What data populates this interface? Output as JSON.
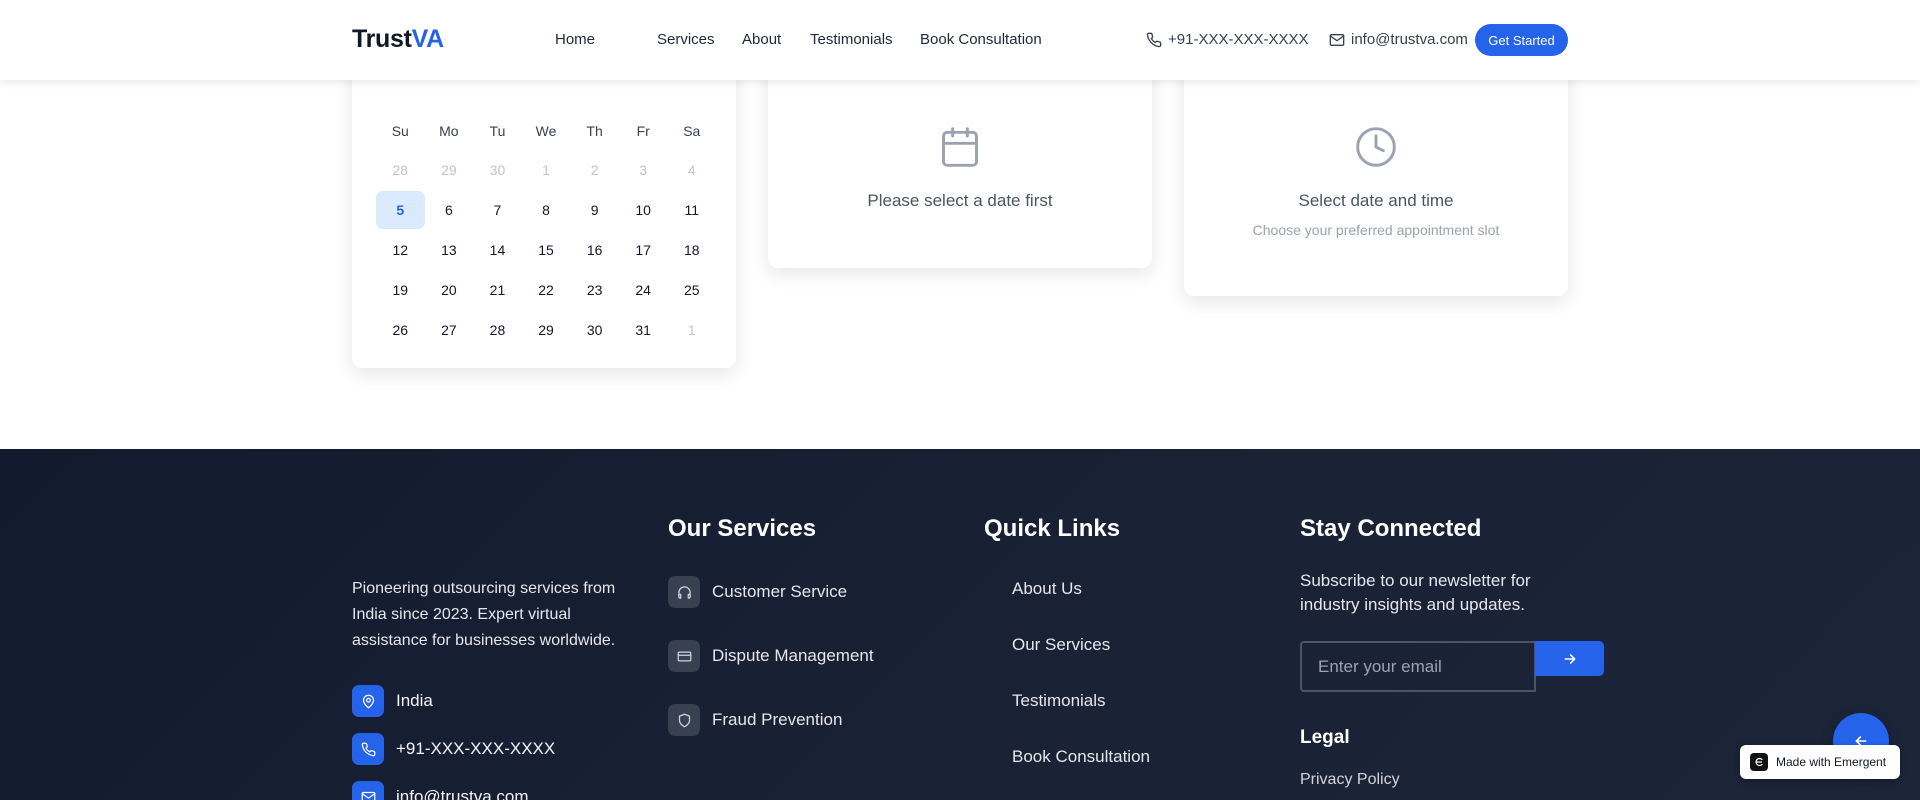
{
  "header": {
    "logo_main": "Trust",
    "logo_accent": "VA",
    "nav": [
      "Home",
      "Services",
      "About",
      "Testimonials",
      "Book Consultation"
    ],
    "phone": "+91-XXX-XXX-XXXX",
    "email": "info@trustva.com",
    "cta_label": "Get Started"
  },
  "calendar": {
    "weekdays": [
      "Su",
      "Mo",
      "Tu",
      "We",
      "Th",
      "Fr",
      "Sa"
    ],
    "rows": [
      [
        "28",
        "29",
        "30",
        "1",
        "2",
        "3",
        "4"
      ],
      [
        "5",
        "6",
        "7",
        "8",
        "9",
        "10",
        "11"
      ],
      [
        "12",
        "13",
        "14",
        "15",
        "16",
        "17",
        "18"
      ],
      [
        "19",
        "20",
        "21",
        "22",
        "23",
        "24",
        "25"
      ],
      [
        "26",
        "27",
        "28",
        "29",
        "30",
        "31",
        "1"
      ]
    ],
    "selected_day": "5"
  },
  "time_slots": {
    "message": "Please select a date first",
    "icon": "calendar-icon"
  },
  "summary": {
    "title": "Select date and time",
    "subtitle": "Choose your preferred appointment slot",
    "icon": "clock-icon"
  },
  "footer": {
    "about_text": "Pioneering outsourcing services from India since 2023. Expert virtual assistance for businesses worldwide.",
    "contact": {
      "location": "India",
      "phone": "+91-XXX-XXX-XXXX",
      "email": "info@trustva.com"
    },
    "services_title": "Our Services",
    "services": [
      {
        "label": "Customer Service",
        "icon": "headphones-icon"
      },
      {
        "label": "Dispute Management",
        "icon": "credit-card-icon"
      },
      {
        "label": "Fraud Prevention",
        "icon": "shield-icon"
      }
    ],
    "quick_links_title": "Quick Links",
    "quick_links": [
      "About Us",
      "Our Services",
      "Testimonials",
      "Book Consultation"
    ],
    "stay_title": "Stay Connected",
    "stay_text": "Subscribe to our newsletter for industry insights and updates.",
    "email_placeholder": "Enter your email",
    "legal_title": "Legal",
    "privacy_label": "Privacy Policy"
  },
  "badge": {
    "label": "Made with Emergent"
  },
  "colors": {
    "accent": "#2563eb",
    "footer_bg": "#1a2236",
    "selected_day_bg": "#dbeafe"
  }
}
